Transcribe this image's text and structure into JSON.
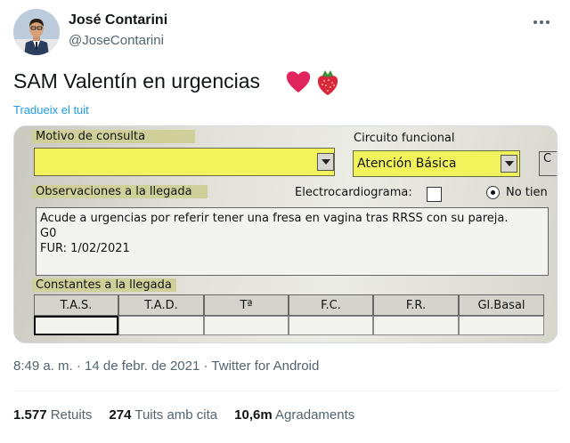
{
  "author": {
    "name": "José Contarini",
    "handle": "@JoseContarini"
  },
  "tweet": {
    "text": "SAM Valentín en urgencias",
    "emojis": [
      "heart-emoji",
      "strawberry-emoji"
    ],
    "translate_label": "Tradueix el tuit"
  },
  "image_form": {
    "motivo_label": "Motivo de consulta",
    "motivo_value": "",
    "circuito_label": "Circuito funcional",
    "circuito_value": "Atención Básica",
    "side_button_label": "C",
    "observaciones_label": "Observaciones a la llegada",
    "ecg_label": "Electrocardiograma:",
    "radio_label": "No tien",
    "notes": [
      "Acude a urgencias por referir tener una fresa en vagina tras RRSS con su pareja.",
      "G0",
      "FUR: 1/02/2021"
    ],
    "constantes_label": "Constantes a la llegada",
    "columns": [
      "T.A.S.",
      "T.A.D.",
      "Tª",
      "F.C.",
      "F.R.",
      "Gl.Basal"
    ]
  },
  "meta": {
    "time": "8:49 a. m.",
    "sep1": "·",
    "date": "14 de febr. de 2021",
    "sep2": "·",
    "source": "Twitter for Android"
  },
  "stats": [
    {
      "value": "1.577",
      "label": "Retuits"
    },
    {
      "value": "274",
      "label": "Tuits amb cita"
    },
    {
      "value": "10,6m",
      "label": "Agradaments"
    }
  ],
  "colors": {
    "link": "#1d9bf0",
    "secondary_text": "#536471",
    "highlight_yellow": "#f2f25c",
    "heart": "#e0245e"
  }
}
